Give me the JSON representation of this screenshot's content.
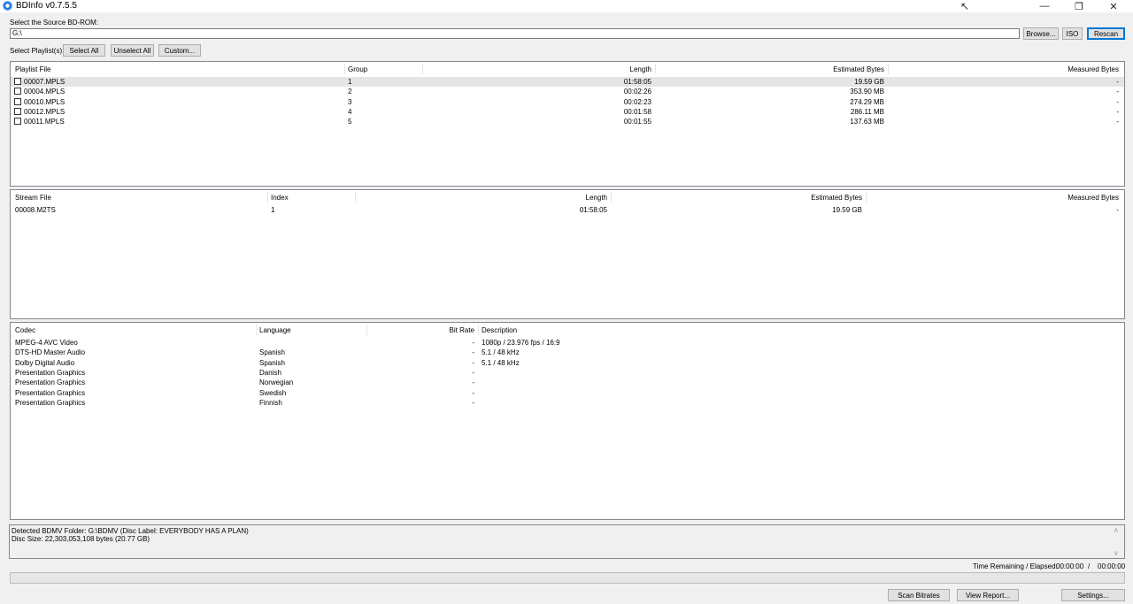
{
  "window": {
    "title": "BDInfo v0.7.5.5"
  },
  "source": {
    "label": "Select the Source BD-ROM:",
    "path": "G:\\",
    "browse_label": "Browse...",
    "iso_label": "ISO",
    "rescan_label": "Rescan"
  },
  "playlists_bar": {
    "label": "Select Playlist(s):",
    "select_all": "Select All",
    "unselect_all": "Unselect All",
    "custom": "Custom..."
  },
  "playlist_table": {
    "headers": [
      "Playlist File",
      "Group",
      "Length",
      "Estimated Bytes",
      "Measured Bytes"
    ],
    "rows": [
      {
        "file": "00007.MPLS",
        "group": "1",
        "length": "01:58:05",
        "est": "19.59 GB",
        "meas": "-"
      },
      {
        "file": "00004.MPLS",
        "group": "2",
        "length": "00:02:26",
        "est": "353.90 MB",
        "meas": "-"
      },
      {
        "file": "00010.MPLS",
        "group": "3",
        "length": "00:02:23",
        "est": "274.29 MB",
        "meas": "-"
      },
      {
        "file": "00012.MPLS",
        "group": "4",
        "length": "00:01:58",
        "est": "286.11 MB",
        "meas": "-"
      },
      {
        "file": "00011.MPLS",
        "group": "5",
        "length": "00:01:55",
        "est": "137.63 MB",
        "meas": "-"
      }
    ]
  },
  "stream_table": {
    "headers": [
      "Stream File",
      "Index",
      "Length",
      "Estimated Bytes",
      "Measured Bytes"
    ],
    "rows": [
      {
        "file": "00008.M2TS",
        "index": "1",
        "length": "01:58:05",
        "est": "19.59 GB",
        "meas": "-"
      }
    ]
  },
  "codec_table": {
    "headers": [
      "Codec",
      "Language",
      "Bit Rate",
      "Description"
    ],
    "rows": [
      {
        "codec": "MPEG-4 AVC Video",
        "lang": "",
        "bitrate": "-",
        "desc": "1080p / 23.976 fps / 16:9"
      },
      {
        "codec": "DTS-HD Master Audio",
        "lang": "Spanish",
        "bitrate": "-",
        "desc": "5.1 / 48 kHz"
      },
      {
        "codec": "Dolby Digital Audio",
        "lang": "Spanish",
        "bitrate": "-",
        "desc": "5.1 / 48 kHz"
      },
      {
        "codec": "Presentation Graphics",
        "lang": "Danish",
        "bitrate": "-",
        "desc": ""
      },
      {
        "codec": "Presentation Graphics",
        "lang": "Norwegian",
        "bitrate": "-",
        "desc": ""
      },
      {
        "codec": "Presentation Graphics",
        "lang": "Swedish",
        "bitrate": "-",
        "desc": ""
      },
      {
        "codec": "Presentation Graphics",
        "lang": "Finnish",
        "bitrate": "-",
        "desc": ""
      }
    ]
  },
  "status": {
    "line1": "Detected BDMV Folder: G:\\BDMV (Disc Label: EVERYBODY HAS A PLAN)",
    "line2": "Disc Size: 22,303,053,108 bytes (20.77 GB)"
  },
  "timing": {
    "label": "Time Remaining / Elapsed:",
    "remaining": "00:00:00",
    "separator": "/",
    "elapsed": "00:00:00"
  },
  "progress": 0,
  "bottom_buttons": {
    "scan_bitrates": "Scan Bitrates",
    "view_report": "View Report...",
    "settings": "Settings..."
  },
  "colors": {
    "accent": "#0078d7",
    "selected_row": "#e5e5e5"
  }
}
